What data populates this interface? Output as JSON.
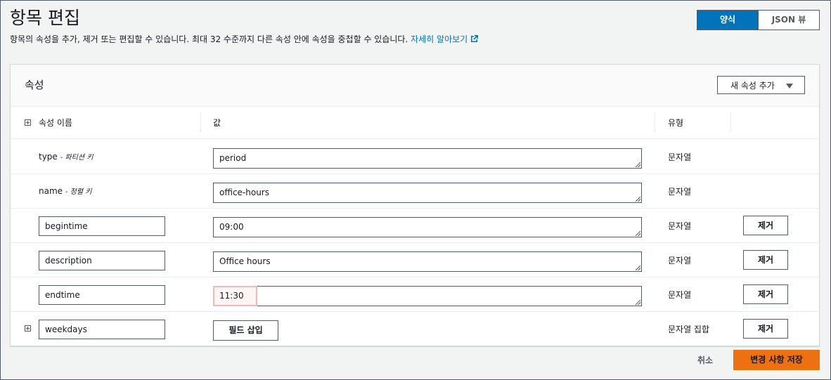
{
  "page": {
    "title": "항목 편집",
    "subtitle": "항목의 속성을 추가, 제거 또는 편집할 수 있습니다. 최대 32 수준까지 다른 속성 안에 속성을 중첩할 수 있습니다.",
    "learn_more": "자세히 알아보기",
    "learn_more_icon": "external-link-icon"
  },
  "view_toggle": {
    "form": "양식",
    "json": "JSON 뷰",
    "selected": "form"
  },
  "attributes": {
    "panel_title": "속성",
    "add_button": "새 속성 추가",
    "columns": {
      "name": "속성 이름",
      "value": "값",
      "type": "유형"
    },
    "remove_label": "제거",
    "rows": [
      {
        "name": "type",
        "key_note": "- 파티션 키",
        "value": "period",
        "type": "문자열"
      },
      {
        "name": "name",
        "key_note": "- 정렬 키",
        "value": "office-hours",
        "type": "문자열"
      },
      {
        "name": "begintime",
        "value": "09:00",
        "type": "문자열"
      },
      {
        "name": "description",
        "value": "Office hours",
        "type": "문자열"
      },
      {
        "name": "endtime",
        "value": "11:30",
        "type": "문자열"
      },
      {
        "name": "weekdays",
        "insert_label": "필드 삽입",
        "type": "문자열 집합"
      }
    ]
  },
  "footer": {
    "cancel": "취소",
    "save": "변경 사항 저장"
  },
  "colors": {
    "primary": "#0073bb",
    "save": "#ec7211",
    "highlight": "#f3b9b9"
  }
}
